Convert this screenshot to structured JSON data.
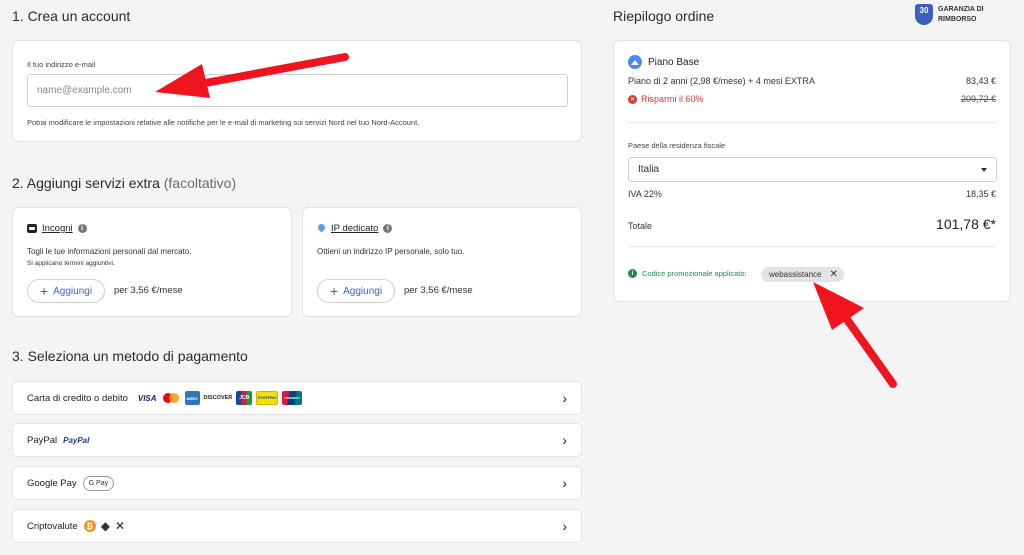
{
  "account": {
    "heading": "1. Crea un account",
    "email_label": "Il tuo indirizzo e-mail",
    "email_placeholder": "name@example.com",
    "email_value": "",
    "note": "Potrai modificare le impostazioni relative alle notifiche per le e-mail di marketing sui servizi Nord nel tuo Nord-Account."
  },
  "extras": {
    "heading": "2. Aggiungi servizi extra",
    "heading_muted": "(facoltativo)",
    "items": [
      {
        "title": "Incogni",
        "desc": "Togli le tue informazioni personali dal mercato.",
        "subdesc": "Si applicano termini aggiuntivi.",
        "button": "Aggiungi",
        "price_prefix": "per",
        "price": "3,56 €/mese"
      },
      {
        "title": "IP dedicato",
        "desc": "Ottieni un indirizzo IP personale, solo tuo.",
        "subdesc": "",
        "button": "Aggiungi",
        "price_prefix": "per",
        "price": "3,56 €/mese"
      }
    ]
  },
  "payment": {
    "heading": "3. Seleziona un metodo di pagamento",
    "methods": [
      {
        "label": "Carta di credito o debito",
        "logos": [
          "VISA",
          "MC",
          "AMEX",
          "DISCOVER",
          "JCB",
          "POSTEPAY",
          "UNIONPAY"
        ]
      },
      {
        "label": "PayPal",
        "logos": [
          "PayPal"
        ]
      },
      {
        "label": "Google Pay",
        "logos": [
          "G Pay"
        ]
      },
      {
        "label": "Criptovalute",
        "logos": [
          "bitcoin",
          "ethereum",
          "xrp"
        ]
      }
    ],
    "chevron": "›"
  },
  "summary": {
    "heading": "Riepilogo ordine",
    "guarantee_days": "30",
    "guarantee_text_1": "GARANZIA DI",
    "guarantee_text_2": "RIMBORSO",
    "plan_name": "Piano Base",
    "plan_desc": "Piano di 2 anni (2,98 €/mese) + 4 mesi EXTRA",
    "plan_price": "83,43 €",
    "savings_label": "Risparmi il 60%",
    "original_price": "209,72 €",
    "country_label": "Paese della residenza fiscale",
    "country_value": "Italia",
    "vat_label": "IVA 22%",
    "vat_value": "18,35 €",
    "total_label": "Totale",
    "total_value": "101,78 €*",
    "promo_label": "Codice promozionale applicato:",
    "promo_code": "webassistance"
  },
  "colors": {
    "accent_blue": "#3e5fbf",
    "savings_red": "#d93a3a",
    "promo_green": "#1e8a4e",
    "arrow_red": "#f0141e"
  }
}
